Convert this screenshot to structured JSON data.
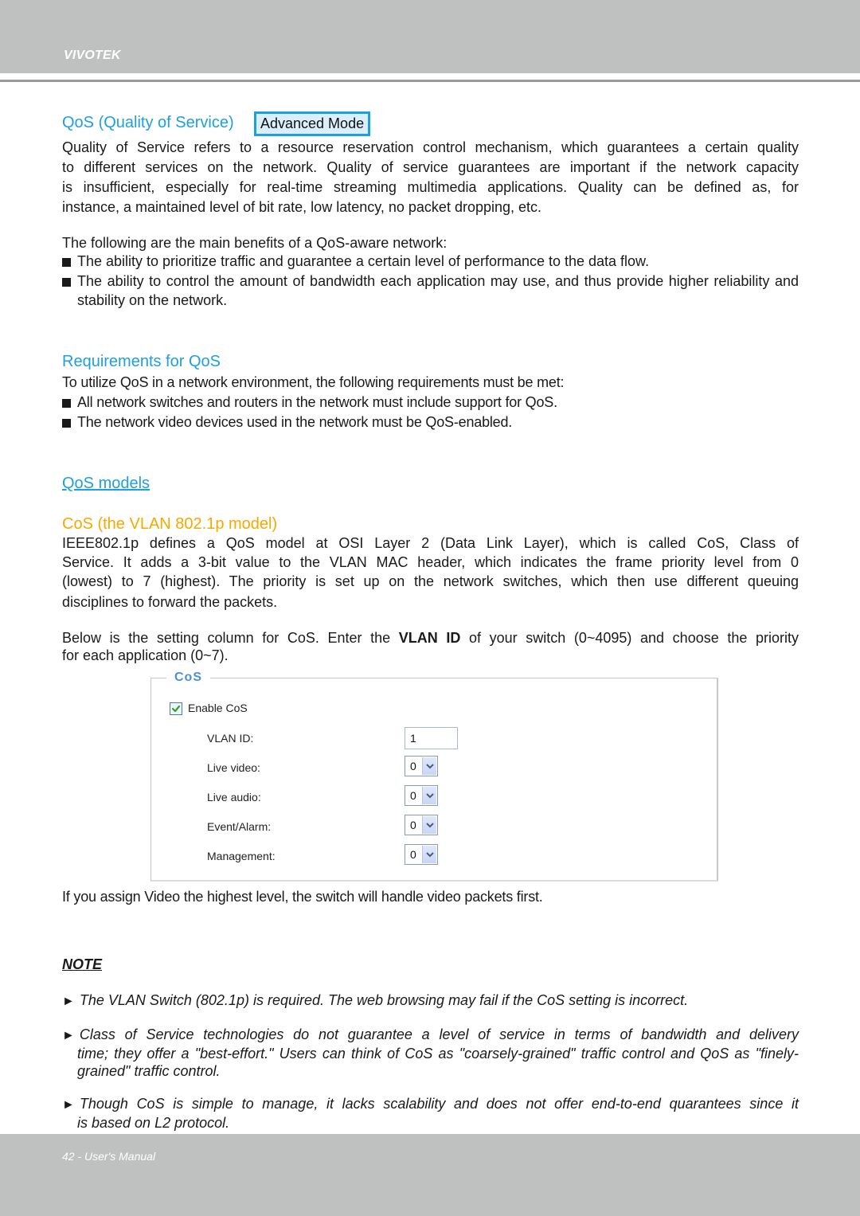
{
  "header": {
    "brand": "VIVOTEK"
  },
  "qos": {
    "title": "QoS (Quality of Service)",
    "mode_button": "Advanced Mode",
    "intro_lines": [
      "Quality of Service refers to a resource reservation control mechanism, which guarantees a certain quality",
      "to different services on the network. Quality of service guarantees are important if the network capacity",
      "is insufficient, especially for real-time streaming multimedia applications. Quality can be defined as, for",
      "instance, a maintained level of bit rate, low latency, no packet dropping, etc."
    ],
    "benefits_intro": "The following are the main benefits of a QoS-aware network:",
    "benefits": [
      "The ability to prioritize traffic and guarantee a certain level of performance to the data flow.",
      "The ability to control the amount of bandwidth each application may use, and thus provide higher reliability and stability on the network."
    ]
  },
  "requirements": {
    "title": "Requirements for QoS",
    "intro": "To utilize QoS in a network environment, the following requirements must be met:",
    "items": [
      "All network switches and routers in the network must include support for QoS.",
      "The network video devices used in the network must be QoS-enabled."
    ]
  },
  "models": {
    "link": "QoS models",
    "cos_title": "CoS (the VLAN 802.1p model)",
    "cos_lines": [
      "IEEE802.1p defines a QoS model at OSI Layer 2 (Data Link Layer), which is called CoS, Class of",
      "Service. It adds a 3-bit value to the VLAN MAC header, which indicates the frame priority level from 0",
      "(lowest) to 7 (highest). The priority is set up on the network switches, which then use different queuing",
      "disciplines to forward the packets."
    ],
    "setting_pre": "Below is the setting column for CoS. Enter the ",
    "setting_bold": "VLAN ID",
    "setting_post": " of your switch (0~4095) and choose the priority",
    "setting_line2": "for each application (0~7)."
  },
  "cos_panel": {
    "legend": "CoS",
    "enable_label": "Enable CoS",
    "enable_checked": true,
    "vlan_label": "VLAN ID:",
    "vlan_value": "1",
    "fields": [
      {
        "label": "Live video:",
        "value": "0"
      },
      {
        "label": "Live audio:",
        "value": "0"
      },
      {
        "label": "Event/Alarm:",
        "value": "0"
      },
      {
        "label": "Management:",
        "value": "0"
      }
    ]
  },
  "after_panel": "If you assign Video the highest level, the switch will handle video packets first.",
  "note": {
    "title": "NOTE",
    "items": [
      {
        "line1": "The VLAN Switch (802.1p) is required.  The web browsing may fail if the CoS setting is incorrect.",
        "rest": ""
      },
      {
        "line1": "Class of Service technologies do not guarantee a level of service in terms of bandwidth and delivery",
        "rest": "time; they offer a \"best-effort.\" Users can think of CoS as \"coarsely-grained\" traffic control and QoS as \"finely-grained\" traffic control."
      },
      {
        "line1": "Though CoS is simple to manage, it lacks scalability and does not offer end-to-end quarantees since it",
        "rest": "is based on L2 protocol."
      }
    ]
  },
  "footer": {
    "page_label": "42 - User's Manual"
  },
  "colors": {
    "heading_blue": "#1ea0dc",
    "heading_orange": "#f7a800",
    "band_gray": "#bfc1c0"
  }
}
